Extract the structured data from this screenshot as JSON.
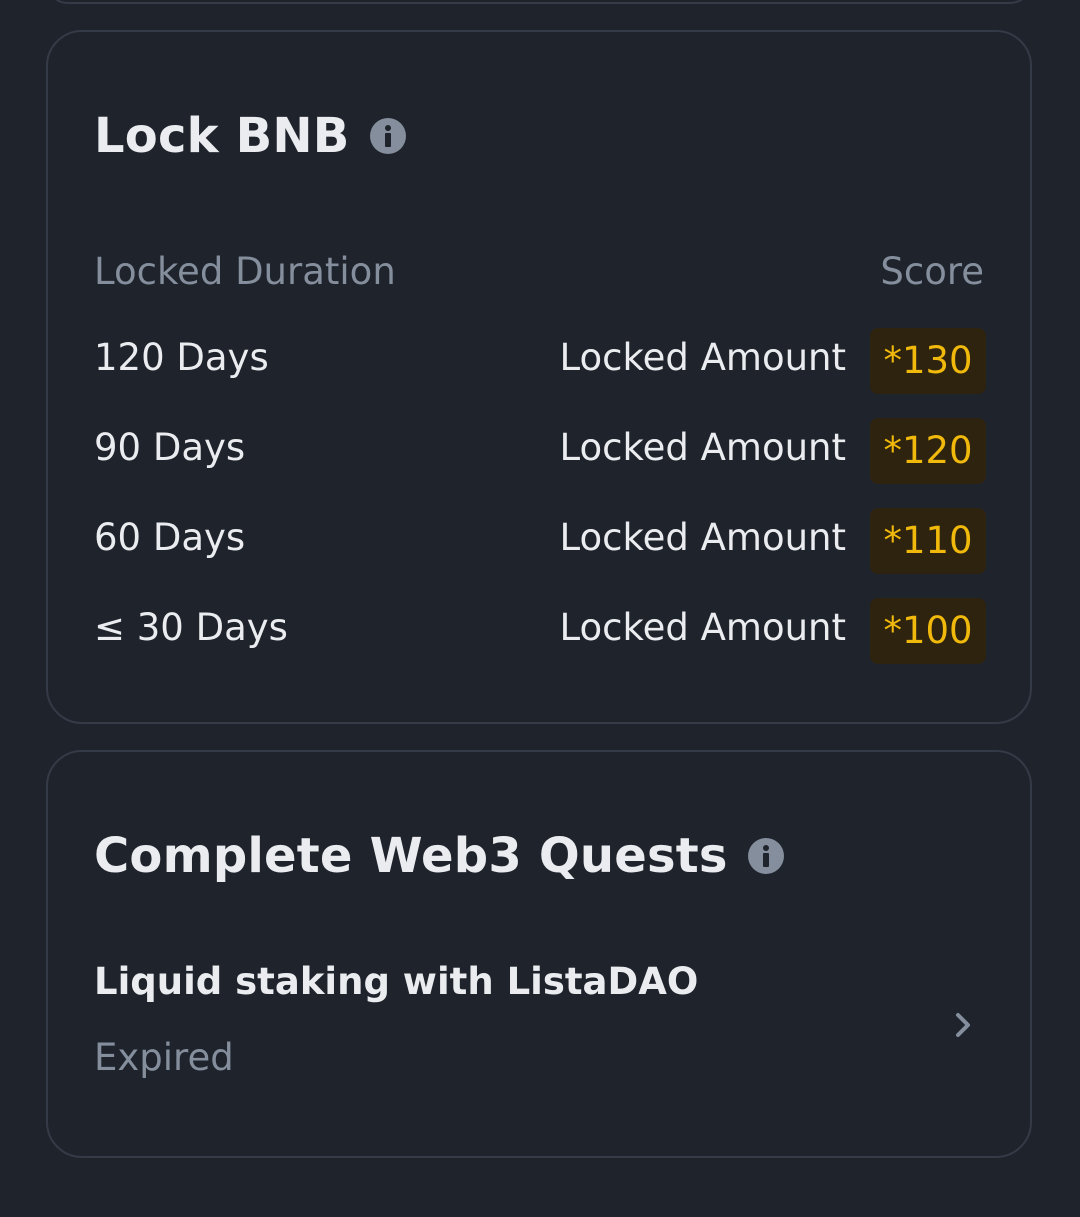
{
  "lock_card": {
    "title": "Lock BNB",
    "info_icon": "info-icon",
    "column_duration": "Locked Duration",
    "column_score": "Score",
    "rows": [
      {
        "duration": "120 Days",
        "amount_label": "Locked Amount",
        "multiplier": "*130"
      },
      {
        "duration": "90 Days",
        "amount_label": "Locked Amount",
        "multiplier": "*120"
      },
      {
        "duration": "60 Days",
        "amount_label": "Locked Amount",
        "multiplier": "*110"
      },
      {
        "duration": "≤ 30 Days",
        "amount_label": "Locked Amount",
        "multiplier": "*100"
      }
    ]
  },
  "quests_card": {
    "title": "Complete Web3 Quests",
    "info_icon": "info-icon",
    "items": [
      {
        "title": "Liquid staking with ListaDAO",
        "status": "Expired",
        "icon": "chevron-right-icon"
      }
    ]
  },
  "colors": {
    "background": "#1f232c",
    "card_border": "#343a46",
    "text_primary": "#eaecef",
    "text_secondary": "#848e9c",
    "accent": "#f0b90b",
    "badge_bg": "#2e230e"
  }
}
